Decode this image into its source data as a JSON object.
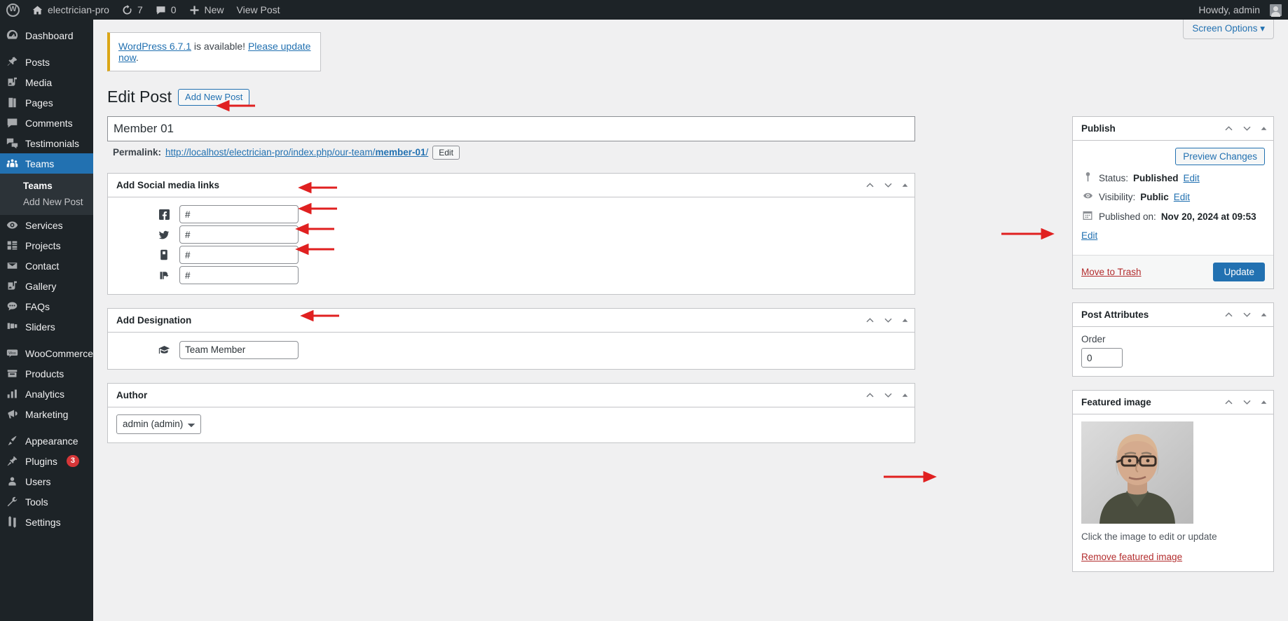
{
  "adminbar": {
    "logo_icon": "wordpress-logo-icon",
    "site_name": "electrician-pro",
    "site_icon": "home-icon",
    "updates_icon": "updates-icon",
    "updates_count": "7",
    "comments_icon": "comment-bubble-icon",
    "comments_count": "0",
    "new_icon": "plus-icon",
    "new_label": "New",
    "view_post_label": "View Post",
    "howdy": "Howdy, admin",
    "avatar_icon": "avatar-icon"
  },
  "sidebar": {
    "items": [
      {
        "label": "Dashboard",
        "icon": "dashboard-icon",
        "active": false
      },
      {
        "label": "Posts",
        "icon": "pin-icon",
        "active": false
      },
      {
        "label": "Media",
        "icon": "media-icon",
        "active": false
      },
      {
        "label": "Pages",
        "icon": "pages-icon",
        "active": false
      },
      {
        "label": "Comments",
        "icon": "comments-icon",
        "active": false
      },
      {
        "label": "Testimonials",
        "icon": "testimonials-icon",
        "active": false
      },
      {
        "label": "Teams",
        "icon": "teams-icon",
        "active": true
      },
      {
        "label": "Services",
        "icon": "services-icon",
        "active": false
      },
      {
        "label": "Projects",
        "icon": "projects-icon",
        "active": false
      },
      {
        "label": "Contact",
        "icon": "envelope-icon",
        "active": false
      },
      {
        "label": "Gallery",
        "icon": "gallery-icon",
        "active": false
      },
      {
        "label": "FAQs",
        "icon": "faqs-icon",
        "active": false
      },
      {
        "label": "Sliders",
        "icon": "sliders-icon",
        "active": false
      },
      {
        "label": "WooCommerce",
        "icon": "woocommerce-icon",
        "active": false
      },
      {
        "label": "Products",
        "icon": "products-icon",
        "active": false
      },
      {
        "label": "Analytics",
        "icon": "analytics-icon",
        "active": false
      },
      {
        "label": "Marketing",
        "icon": "marketing-icon",
        "active": false
      },
      {
        "label": "Appearance",
        "icon": "appearance-icon",
        "active": false
      },
      {
        "label": "Plugins",
        "icon": "plugins-icon",
        "badge": "3",
        "active": false
      },
      {
        "label": "Users",
        "icon": "users-icon",
        "active": false
      },
      {
        "label": "Tools",
        "icon": "tools-icon",
        "active": false
      },
      {
        "label": "Settings",
        "icon": "settings-icon",
        "active": false
      }
    ],
    "submenu": {
      "parent": "Teams",
      "items": [
        {
          "label": "Teams",
          "current": true
        },
        {
          "label": "Add New Post",
          "current": false
        }
      ]
    }
  },
  "screen_meta": {
    "screen_options_label": "Screen Options",
    "chevron_icon": "chevron-down-icon"
  },
  "notice": {
    "link_version": "WordPress 6.7.1",
    "text_middle": " is available! ",
    "link_update": "Please update now",
    "text_end": "."
  },
  "page": {
    "title": "Edit Post",
    "add_new_label": "Add New Post"
  },
  "post": {
    "title_value": "Member 01",
    "title_placeholder": "Add title",
    "permalink_label": "Permalink:",
    "permalink_prefix": "http://localhost/electrician-pro/index.php/our-team/",
    "permalink_slug": "member-01",
    "permalink_suffix": "/",
    "edit_slug_label": "Edit"
  },
  "social_box": {
    "title": "Add Social media links",
    "fields": [
      {
        "icon": "facebook-icon",
        "value": "#",
        "name": "facebook"
      },
      {
        "icon": "twitter-icon",
        "value": "#",
        "name": "twitter"
      },
      {
        "icon": "instagram-icon",
        "value": "#",
        "name": "instagram"
      },
      {
        "icon": "pinterest-icon",
        "value": "#",
        "name": "pinterest"
      }
    ]
  },
  "designation_box": {
    "title": "Add Designation",
    "icon": "graduation-cap-icon",
    "value": "Team Member"
  },
  "author_box": {
    "title": "Author",
    "selected": "admin (admin)"
  },
  "publish_box": {
    "title": "Publish",
    "preview_label": "Preview Changes",
    "status_icon": "post-status-icon",
    "status_label": "Status:",
    "status_value": "Published",
    "status_edit": "Edit",
    "visibility_icon": "eye-icon",
    "visibility_label": "Visibility:",
    "visibility_value": "Public",
    "visibility_edit": "Edit",
    "published_icon": "calendar-icon",
    "published_label": "Published on:",
    "published_value": "Nov 20, 2024 at 09:53",
    "published_edit": "Edit",
    "trash_label": "Move to Trash",
    "update_label": "Update"
  },
  "attributes_box": {
    "title": "Post Attributes",
    "order_label": "Order",
    "order_value": "0"
  },
  "featured_box": {
    "title": "Featured image",
    "image_alt": "featured-image-thumbnail",
    "caption": "Click the image to edit or update",
    "remove_label": "Remove featured image"
  },
  "handle_icons": {
    "up": "chevron-up-icon",
    "down": "chevron-down-icon",
    "toggle": "caret-up-icon"
  },
  "colors": {
    "admin_blue": "#2271b1",
    "sidebar_dark": "#1d2327",
    "accent_red": "#d63638",
    "notice_yellow": "#dba617",
    "arrow_red": "#e02020"
  }
}
